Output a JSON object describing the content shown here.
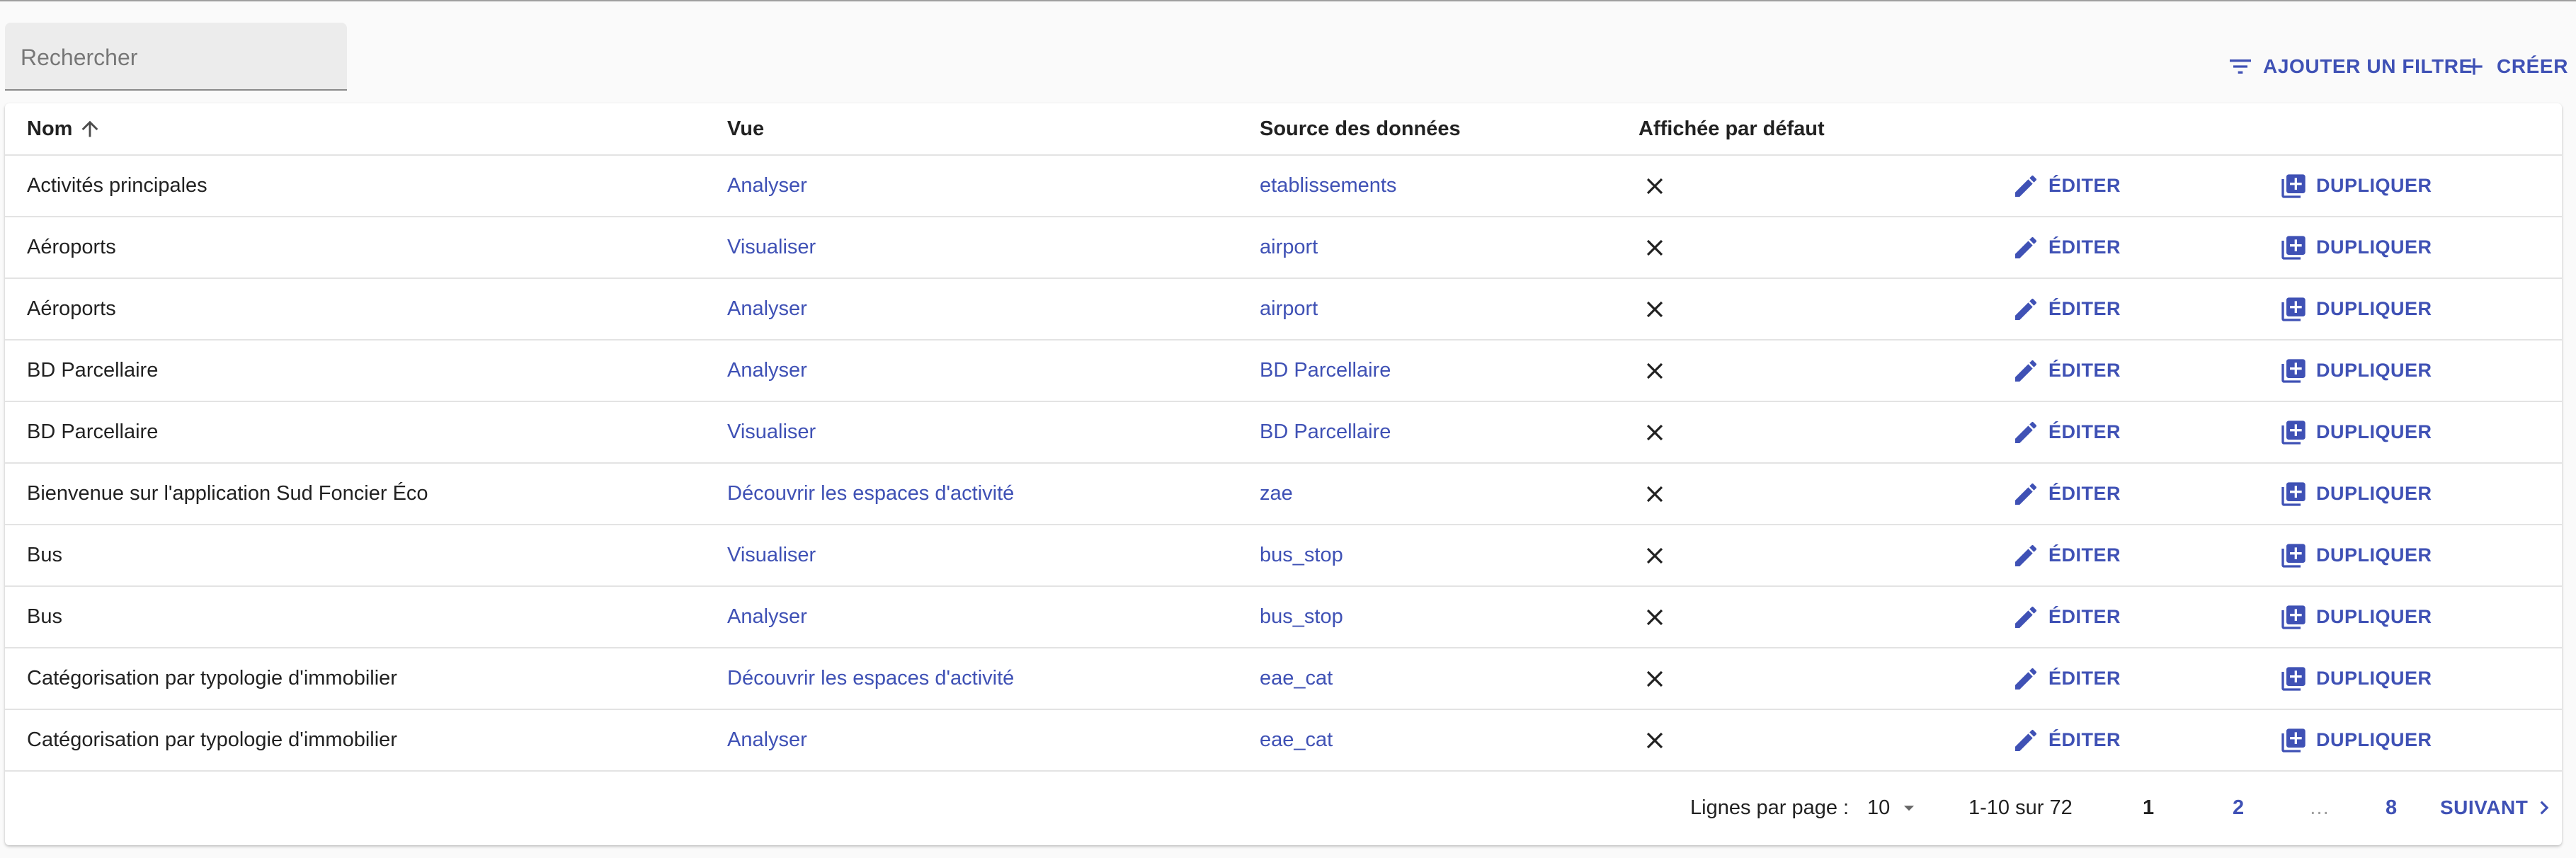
{
  "search": {
    "placeholder": "Rechercher"
  },
  "toolbar": {
    "filter_label": "AJOUTER UN FILTRE",
    "create_label": "CRÉER"
  },
  "table": {
    "headers": {
      "name": "Nom",
      "vue": "Vue",
      "source": "Source des données",
      "default": "Affichée par défaut"
    },
    "sort": {
      "column": "name",
      "direction": "ascending"
    },
    "edit_label": "ÉDITER",
    "duplicate_label": "DUPLIQUER",
    "rows": [
      {
        "name": "Activités principales",
        "vue": "Analyser",
        "source": "etablissements",
        "default": "no"
      },
      {
        "name": "Aéroports",
        "vue": "Visualiser",
        "source": "airport",
        "default": "no"
      },
      {
        "name": "Aéroports",
        "vue": "Analyser",
        "source": "airport",
        "default": "no"
      },
      {
        "name": "BD Parcellaire",
        "vue": "Analyser",
        "source": "BD Parcellaire",
        "default": "no"
      },
      {
        "name": "BD Parcellaire",
        "vue": "Visualiser",
        "source": "BD Parcellaire",
        "default": "no"
      },
      {
        "name": "Bienvenue sur l'application Sud Foncier Éco",
        "vue": "Découvrir les espaces d'activité",
        "source": "zae",
        "default": "no"
      },
      {
        "name": "Bus",
        "vue": "Visualiser",
        "source": "bus_stop",
        "default": "no"
      },
      {
        "name": "Bus",
        "vue": "Analyser",
        "source": "bus_stop",
        "default": "no"
      },
      {
        "name": "Catégorisation par typologie d'immobilier",
        "vue": "Découvrir les espaces d'activité",
        "source": "eae_cat",
        "default": "no"
      },
      {
        "name": "Catégorisation par typologie d'immobilier",
        "vue": "Analyser",
        "source": "eae_cat",
        "default": "no"
      }
    ]
  },
  "pagination": {
    "rows_per_page_label": "Lignes par page :",
    "rows_per_page": "10",
    "range": "1-10 sur 72",
    "pages": [
      "1",
      "2",
      "…",
      "8"
    ],
    "current_page": "1",
    "next_label": "SUIVANT"
  },
  "colors": {
    "accent": "#3f51b5",
    "background": "#fafafa",
    "card": "#ffffff"
  }
}
